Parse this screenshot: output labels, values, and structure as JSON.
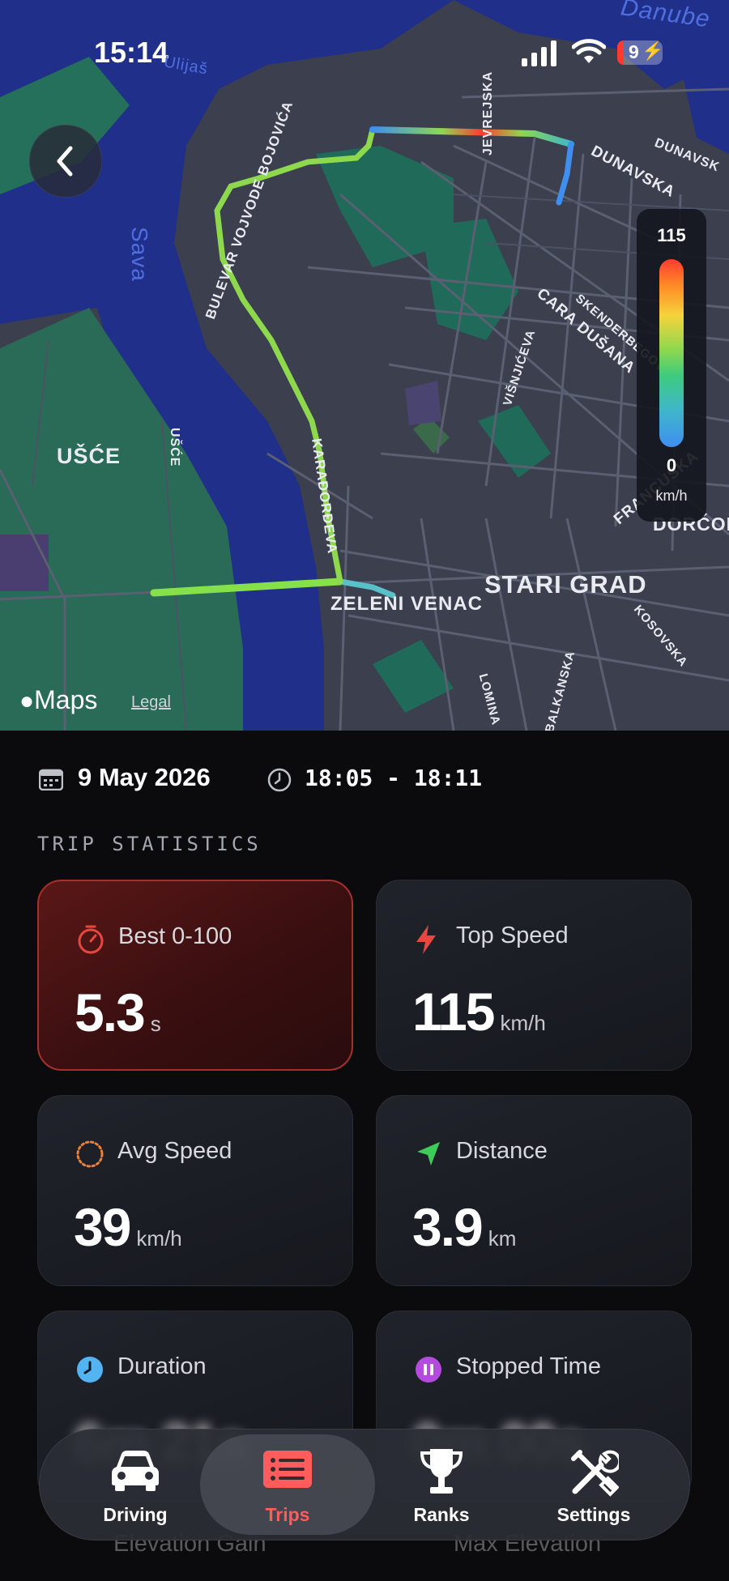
{
  "status_bar": {
    "time": "15:14",
    "battery": "9"
  },
  "map": {
    "provider": "Maps",
    "legal": "Legal",
    "labels": {
      "danube": "Danube",
      "sava": "Sava",
      "usce_area": "UŠĆE",
      "usce_street": "UŠĆE",
      "bulevar": "BULEVAR VOJVODE BOJOVIĆA",
      "jevrejska": "JEVREJSKA",
      "dunavska": "DUNAVSKA",
      "dunavsk": "DUNAVSK",
      "cara_dusana": "CARA DUŠANA",
      "skenderbegova": "SKENDERBEGOVA",
      "visnjiceva": "VIŠNJIĆEVA",
      "francuska": "FRANCUSKA",
      "dorcol": "DORĆOL",
      "karadjordjeva": "KARAĐORĐEVA",
      "zeleni_venac": "ZELENI VENAC",
      "stari_grad": "STARI GRAD",
      "kosovska": "KOSOVSKA",
      "balkanska": "BALKANSKA",
      "lomina": "LOMINA",
      "ulijas": "Ulijaš"
    },
    "speed_legend": {
      "max": "115",
      "min": "0",
      "unit": "km/h"
    },
    "colors": {
      "water": "#1f2f8a",
      "land": "#3c4050",
      "park": "#1f6a58"
    }
  },
  "trip": {
    "date": "9 May 2026",
    "time_range": "18:05 - 18:11"
  },
  "stats": {
    "title": "TRIP STATISTICS",
    "cards": [
      {
        "label": "Best 0-100",
        "value": "5.3",
        "unit": "s",
        "icon": "stopwatch-icon",
        "color": "#e8473f"
      },
      {
        "label": "Top Speed",
        "value": "115",
        "unit": "km/h",
        "icon": "bolt-icon",
        "color": "#e8473f"
      },
      {
        "label": "Avg Speed",
        "value": "39",
        "unit": "km/h",
        "icon": "dotted-circle-icon",
        "color": "#e8823a"
      },
      {
        "label": "Distance",
        "value": "3.9",
        "unit": "km",
        "icon": "location-arrow-icon",
        "color": "#3ecb5a"
      },
      {
        "label": "Duration",
        "value": "6m 21s",
        "unit": "",
        "icon": "clock-icon",
        "color": "#52b4f0"
      },
      {
        "label": "Stopped Time",
        "value": "0m 00s",
        "unit": "",
        "icon": "pause-icon",
        "color": "#b54adf"
      }
    ],
    "peek": [
      "Elevation Gain",
      "Max Elevation"
    ]
  },
  "tabbar": {
    "tabs": [
      {
        "label": "Driving",
        "icon": "car-icon"
      },
      {
        "label": "Trips",
        "icon": "list-icon",
        "active": true
      },
      {
        "label": "Ranks",
        "icon": "trophy-icon"
      },
      {
        "label": "Settings",
        "icon": "tools-icon"
      }
    ],
    "active_color": "#ff5c5c"
  }
}
